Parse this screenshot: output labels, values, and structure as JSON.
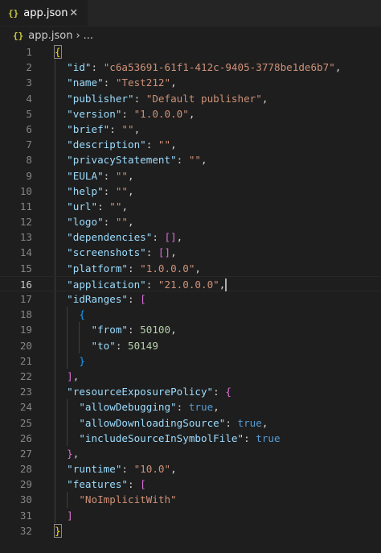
{
  "tab": {
    "icon": "{}",
    "title": "app.json",
    "close_glyph": "✕"
  },
  "breadcrumb": {
    "icon": "{}",
    "file": "app.json",
    "sep": "›",
    "more": "..."
  },
  "code": {
    "line_numbers": [
      "1",
      "2",
      "3",
      "4",
      "5",
      "6",
      "7",
      "8",
      "9",
      "10",
      "11",
      "12",
      "13",
      "14",
      "15",
      "16",
      "17",
      "18",
      "19",
      "20",
      "21",
      "22",
      "23",
      "24",
      "25",
      "26",
      "27",
      "28",
      "29",
      "30",
      "31",
      "32"
    ],
    "current_line": "16",
    "keys": {
      "id": "\"id\"",
      "name": "\"name\"",
      "publisher": "\"publisher\"",
      "version": "\"version\"",
      "brief": "\"brief\"",
      "description": "\"description\"",
      "privacyStatement": "\"privacyStatement\"",
      "EULA": "\"EULA\"",
      "help": "\"help\"",
      "url": "\"url\"",
      "logo": "\"logo\"",
      "dependencies": "\"dependencies\"",
      "screenshots": "\"screenshots\"",
      "platform": "\"platform\"",
      "application": "\"application\"",
      "idRanges": "\"idRanges\"",
      "from": "\"from\"",
      "to": "\"to\"",
      "resourceExposurePolicy": "\"resourceExposurePolicy\"",
      "allowDebugging": "\"allowDebugging\"",
      "allowDownloadingSource": "\"allowDownloadingSource\"",
      "includeSourceInSymbolFile": "\"includeSourceInSymbolFile\"",
      "runtime": "\"runtime\"",
      "features": "\"features\""
    },
    "values": {
      "id": "\"c6a53691-61f1-412c-9405-3778be1de6b7\"",
      "name": "\"Test212\"",
      "publisher": "\"Default publisher\"",
      "version": "\"1.0.0.0\"",
      "empty": "\"\"",
      "platform": "\"1.0.0.0\"",
      "application": "\"21.0.0.0\"",
      "from": "50100",
      "to": "50149",
      "true": "true",
      "runtime": "\"10.0\"",
      "feature0": "\"NoImplicitWith\""
    },
    "punct": {
      "colon": ": ",
      "comma": ",",
      "open_brace": "{",
      "close_brace": "}",
      "open_bracket": "[",
      "close_bracket": "]",
      "empty_array": "[]"
    }
  },
  "colors": {
    "background": "#1e1e1e",
    "key": "#9cdcfe",
    "string": "#ce9178",
    "number": "#b5cea8",
    "keyword": "#569cd6",
    "bracket_level1": "#ffd700",
    "bracket_level2": "#da70d6",
    "bracket_level3": "#179fff"
  }
}
